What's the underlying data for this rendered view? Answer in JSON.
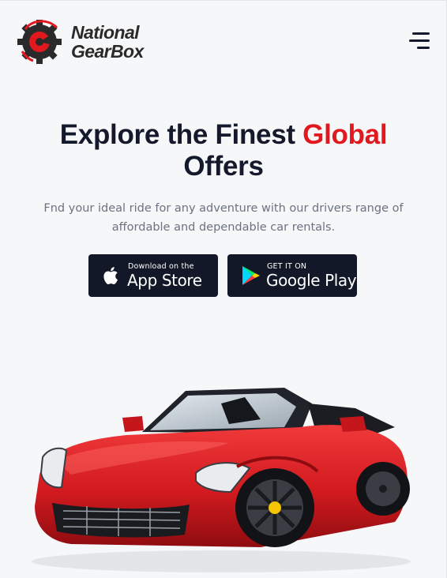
{
  "brand": {
    "line1": "National",
    "line2": "GearBox",
    "logo_icon": "gear-logo-icon",
    "accent_color": "#e1191f"
  },
  "nav": {
    "menu_icon": "hamburger-menu-icon"
  },
  "hero": {
    "title_part1": "Explore the Finest ",
    "title_highlight": "Global",
    "title_part2": "Offers",
    "subtitle": "Fnd your ideal ride for any adventure with our drivers range of affordable and dependable car rentals."
  },
  "app_store": {
    "small": "Download on the",
    "big": "App Store",
    "icon": "apple-icon"
  },
  "google_play": {
    "small": "GET IT ON",
    "big": "Google Play",
    "icon": "google-play-icon"
  },
  "hero_image": {
    "subject": "red convertible sports car"
  },
  "colors": {
    "background": "#f6f7f9",
    "text": "#141a2b",
    "accent": "#e1191f",
    "button_bg": "#121828"
  }
}
